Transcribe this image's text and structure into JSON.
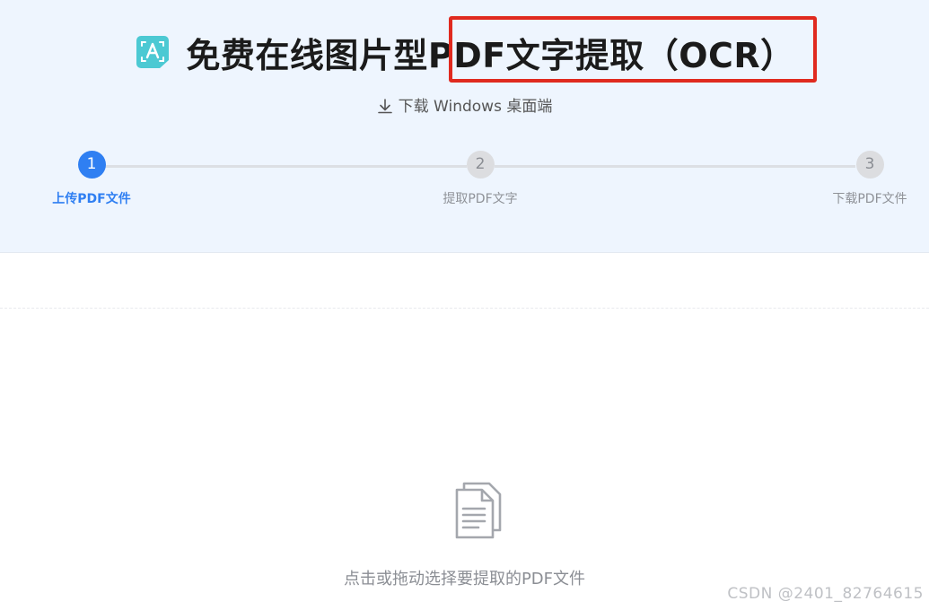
{
  "header": {
    "title": "免费在线图片型PDF文字提取（OCR）",
    "download_label": "下载 Windows 桌面端"
  },
  "steps": [
    {
      "number": "1",
      "label": "上传PDF文件",
      "state": "active"
    },
    {
      "number": "2",
      "label": "提取PDF文字",
      "state": "pending"
    },
    {
      "number": "3",
      "label": "下载PDF文件",
      "state": "pending"
    }
  ],
  "upload": {
    "hint": "点击或拖动选择要提取的PDF文件"
  },
  "watermark": "CSDN @2401_82764615",
  "colors": {
    "accent": "#2f7ff2",
    "logo": "#4cc9d3",
    "highlight": "#e02a1f",
    "header_bg": "#eef5fe"
  },
  "icons": {
    "logo": "ocr-scan-icon",
    "download": "download-arrow-icon",
    "file": "documents-icon"
  }
}
